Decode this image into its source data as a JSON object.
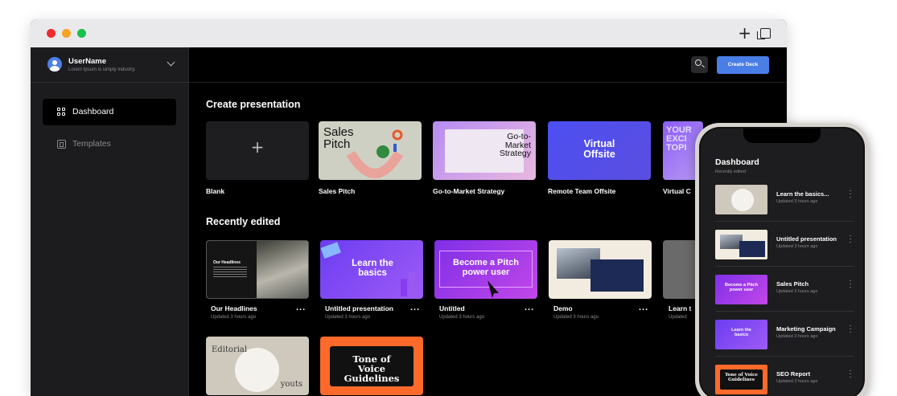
{
  "user": {
    "name": "UserName",
    "subtitle": "Lorem Ipsum is simply industry."
  },
  "nav": [
    {
      "label": "Dashboard",
      "active": true,
      "icon": "grid-icon"
    },
    {
      "label": "Templates",
      "active": false,
      "icon": "template-icon"
    }
  ],
  "header": {
    "create_label": "Create Deck",
    "search_icon": "search-icon"
  },
  "create_section": {
    "title": "Create presentation",
    "templates": [
      {
        "label": "Blank",
        "thumb_text": "+"
      },
      {
        "label": "Sales Pitch",
        "thumb_text": "Sales Pitch"
      },
      {
        "label": "Go-to-Market Strategy",
        "thumb_text": "Go-to-Market Strategy"
      },
      {
        "label": "Remote Team Offsite",
        "thumb_text": "Virtual Offsite"
      },
      {
        "label": "Virtual C",
        "thumb_text": "YOUR EXCI TOPI"
      }
    ]
  },
  "recent_section": {
    "title": "Recently edited",
    "items": [
      {
        "label": "Our Headlines",
        "updated": "Updated 3 hours ago",
        "thumb_text": "Our Headlines"
      },
      {
        "label": "Untitled presentation",
        "updated": "Updated 3 hours ago",
        "thumb_text": "Learn the basics"
      },
      {
        "label": "Untitled",
        "updated": "Updated 3 hours ago",
        "thumb_text": "Become a Pitch power user"
      },
      {
        "label": "Demo",
        "updated": "Updated 3 hours ago",
        "thumb_text": ""
      },
      {
        "label": "Learn t",
        "updated": "Updated",
        "thumb_text": ""
      },
      {
        "label": "",
        "updated": "",
        "thumb_text": "Editorial"
      },
      {
        "label": "",
        "updated": "",
        "thumb_text": "Tone of Voice Guidelines"
      }
    ],
    "editorial_second_line": "youts"
  },
  "more_label": "...",
  "phone": {
    "title": "Dashboard",
    "subtitle": "Recently edited",
    "items": [
      {
        "name": "Learn the basics...",
        "updated": "Updated 3 hours ago",
        "thumb_text": ""
      },
      {
        "name": "Untitled presentation",
        "updated": "Updated 3 hours ago",
        "thumb_text": ""
      },
      {
        "name": "Sales Pitch",
        "updated": "Updated 3 hours ago",
        "thumb_text": "Become a Pitch power user"
      },
      {
        "name": "Marketing Campaign",
        "updated": "Updated 3 hours ago",
        "thumb_text": "Learn the basics"
      },
      {
        "name": "SEO Report",
        "updated": "Updated 3 hours ago",
        "thumb_text": "Tone of Voice Guidelines"
      }
    ]
  },
  "colors": {
    "accent": "#4a7de6",
    "sidebar": "#1c1c1e",
    "background": "#000000"
  }
}
